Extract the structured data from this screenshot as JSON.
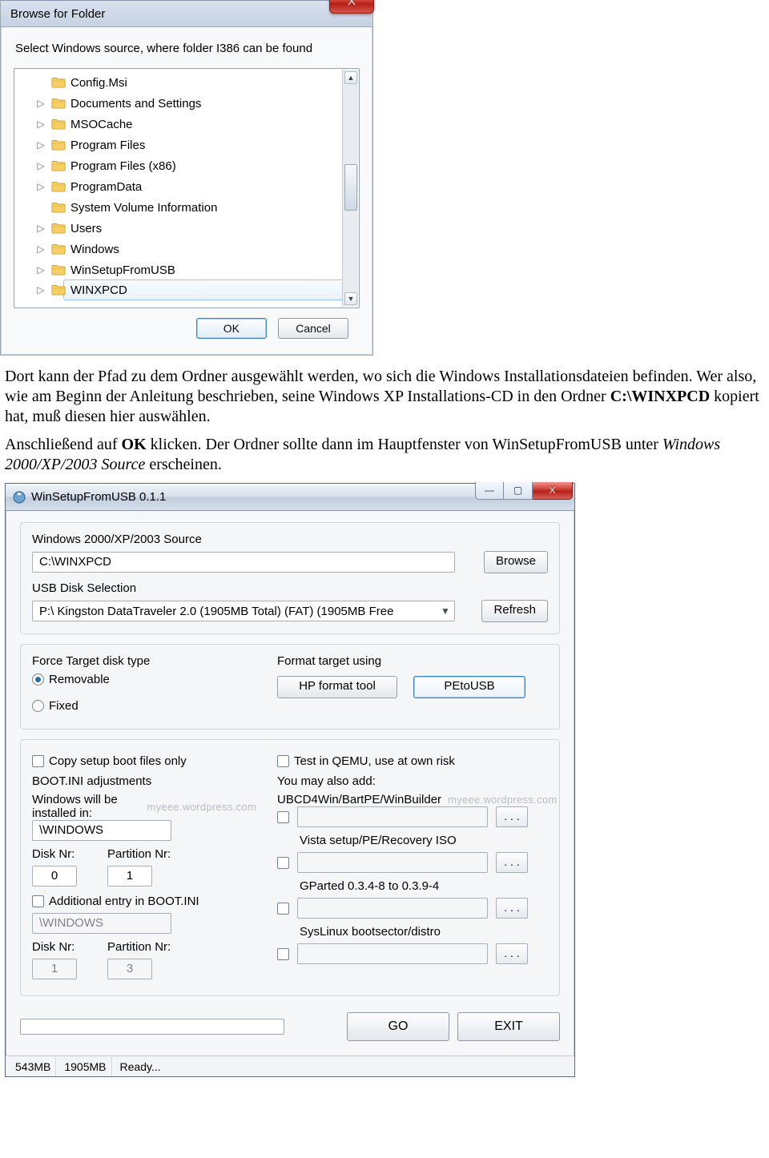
{
  "browse": {
    "title": "Browse for Folder",
    "prompt": "Select Windows source, where folder I386 can be found",
    "ok": "OK",
    "cancel": "Cancel",
    "items": [
      {
        "label": "Config.Msi",
        "expander": false
      },
      {
        "label": "Documents and Settings",
        "expander": true
      },
      {
        "label": "MSOCache",
        "expander": true
      },
      {
        "label": "Program Files",
        "expander": true
      },
      {
        "label": "Program Files (x86)",
        "expander": true
      },
      {
        "label": "ProgramData",
        "expander": true
      },
      {
        "label": "System Volume Information",
        "expander": false
      },
      {
        "label": "Users",
        "expander": true
      },
      {
        "label": "Windows",
        "expander": true
      },
      {
        "label": "WinSetupFromUSB",
        "expander": true
      },
      {
        "label": "WINXPCD",
        "expander": true,
        "selected": true
      }
    ]
  },
  "doc": {
    "p1a": "Dort kann der Pfad zu dem Ordner ausgewählt werden, wo sich die Windows Installationsdateien befinden. Wer also, wie am Beginn der Anleitung beschrieben, seine Windows XP Installations-CD in den Ordner ",
    "p1b": "C:\\WINXPCD",
    "p1c": " kopiert hat, muß diesen hier auswählen.",
    "p2a": "Anschließend auf ",
    "p2b": "OK",
    "p2c": " klicken. Der Ordner sollte dann im Hauptfenster von WinSetupFromUSB unter ",
    "p2d": "Windows 2000/XP/2003 Source",
    "p2e": " erscheinen."
  },
  "wsfu": {
    "title": "WinSetupFromUSB 0.1.1",
    "source_label": "Windows 2000/XP/2003 Source",
    "source_value": "C:\\WINXPCD",
    "browse": "Browse",
    "usb_label": "USB Disk Selection",
    "usb_value": "P:\\ Kingston DataTraveler 2.0 (1905MB Total) (FAT) (1905MB Free",
    "refresh": "Refresh",
    "force_label": "Force Target disk type",
    "radio_removable": "Removable",
    "radio_fixed": "Fixed",
    "format_label": "Format target using",
    "hp_tool": "HP format tool",
    "petousb": "PEtoUSB",
    "copy_only": "Copy setup boot files only",
    "test_qemu": "Test in QEMU, use at own risk",
    "boot_ini": "BOOT.INI adjustments",
    "installed_in": "Windows will be installed in:",
    "win_path_1": "\\WINDOWS",
    "disk_nr": "Disk Nr:",
    "part_nr": "Partition Nr:",
    "disk_val_1": "0",
    "part_val_1": "1",
    "additional_entry": "Additional entry in BOOT.INI",
    "win_path_2": "\\WINDOWS",
    "disk_val_2": "1",
    "part_val_2": "3",
    "also_add": "You may also add:",
    "add_ubcd": "UBCD4Win/BartPE/WinBuilder",
    "add_vista": "Vista setup/PE/Recovery ISO",
    "add_gparted": "GParted 0.3.4-8 to 0.3.9-4",
    "add_syslinux": "SysLinux bootsector/distro",
    "go": "GO",
    "exit": "EXIT",
    "status_a": "543MB",
    "status_b": "1905MB",
    "status_c": "Ready...",
    "watermark_a": "myeee.wordpress.com",
    "watermark_b": "myeee.wordpress.com"
  }
}
